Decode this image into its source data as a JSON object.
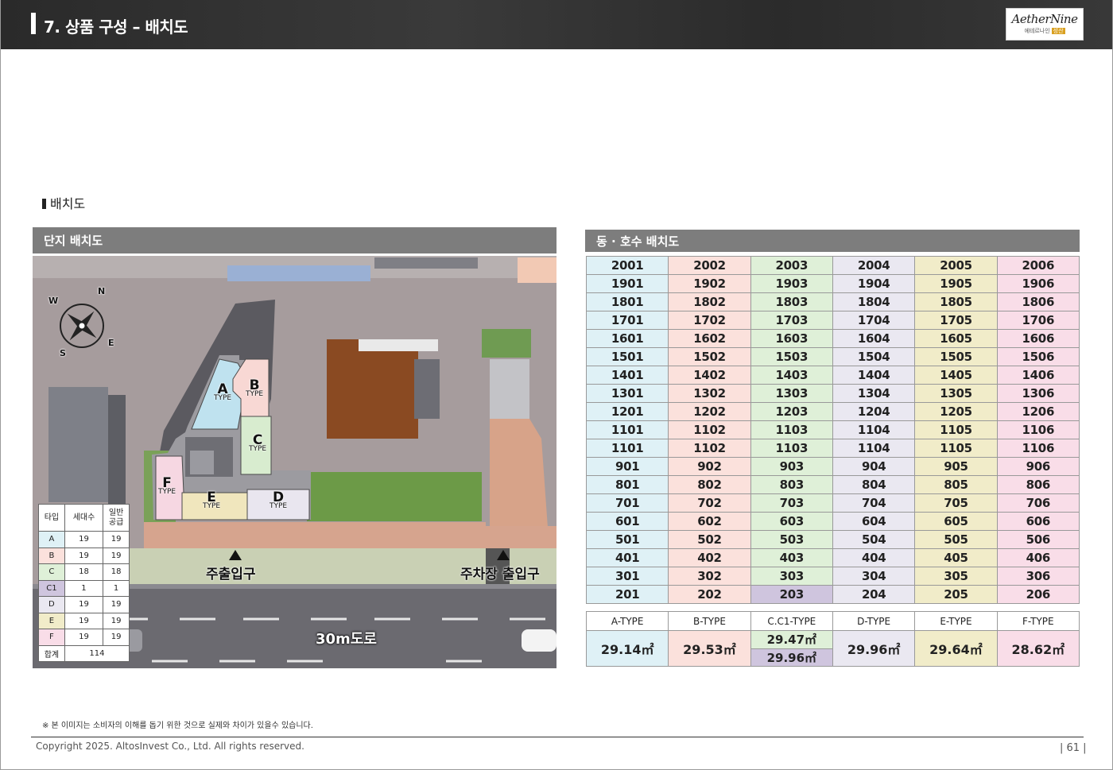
{
  "header": {
    "title": "7. 상품 구성 – 배치도",
    "logo": {
      "name": "AetherNine",
      "sub": "에테르나인",
      "tag": "성산"
    }
  },
  "section_label": "배치도",
  "left_panel": {
    "title": "단지 배치도",
    "compass": [
      "N",
      "E",
      "S",
      "W"
    ],
    "building_labels": [
      {
        "letter": "A",
        "type": "TYPE"
      },
      {
        "letter": "B",
        "type": "TYPE"
      },
      {
        "letter": "C",
        "type": "TYPE"
      },
      {
        "letter": "F",
        "type": "TYPE"
      },
      {
        "letter": "E",
        "type": "TYPE"
      },
      {
        "letter": "D",
        "type": "TYPE"
      }
    ],
    "main_entrance": "주출입구",
    "parking_entrance": "주차장 출입구",
    "road": "30m도로",
    "legend": {
      "headers": [
        "타입",
        "세대수",
        "일반\n공급"
      ],
      "rows": [
        {
          "type": "A",
          "units": "19",
          "supply": "19",
          "color": "#dff1f6"
        },
        {
          "type": "B",
          "units": "19",
          "supply": "19",
          "color": "#fbe1dc"
        },
        {
          "type": "C",
          "units": "18",
          "supply": "18",
          "color": "#dff0d8"
        },
        {
          "type": "C1",
          "units": "1",
          "supply": "1",
          "color": "#cfc5de"
        },
        {
          "type": "D",
          "units": "19",
          "supply": "19",
          "color": "#eae8f1"
        },
        {
          "type": "E",
          "units": "19",
          "supply": "19",
          "color": "#f1ecc9"
        },
        {
          "type": "F",
          "units": "19",
          "supply": "19",
          "color": "#f9dde8"
        }
      ],
      "total_label": "합계",
      "total": "114"
    }
  },
  "right_panel": {
    "title": "동 · 호수 배치도",
    "rows": [
      [
        "2001",
        "2002",
        "2003",
        "2004",
        "2005",
        "2006"
      ],
      [
        "1901",
        "1902",
        "1903",
        "1904",
        "1905",
        "1906"
      ],
      [
        "1801",
        "1802",
        "1803",
        "1804",
        "1805",
        "1806"
      ],
      [
        "1701",
        "1702",
        "1703",
        "1704",
        "1705",
        "1706"
      ],
      [
        "1601",
        "1602",
        "1603",
        "1604",
        "1605",
        "1606"
      ],
      [
        "1501",
        "1502",
        "1503",
        "1504",
        "1505",
        "1506"
      ],
      [
        "1401",
        "1402",
        "1403",
        "1404",
        "1405",
        "1406"
      ],
      [
        "1301",
        "1302",
        "1303",
        "1304",
        "1305",
        "1306"
      ],
      [
        "1201",
        "1202",
        "1203",
        "1204",
        "1205",
        "1206"
      ],
      [
        "1101",
        "1102",
        "1103",
        "1104",
        "1105",
        "1106"
      ],
      [
        "1101",
        "1102",
        "1103",
        "1104",
        "1105",
        "1106"
      ],
      [
        "901",
        "902",
        "903",
        "904",
        "905",
        "906"
      ],
      [
        "801",
        "802",
        "803",
        "804",
        "805",
        "806"
      ],
      [
        "701",
        "702",
        "703",
        "704",
        "705",
        "706"
      ],
      [
        "601",
        "602",
        "603",
        "604",
        "605",
        "606"
      ],
      [
        "501",
        "502",
        "503",
        "504",
        "505",
        "506"
      ],
      [
        "401",
        "402",
        "403",
        "404",
        "405",
        "406"
      ],
      [
        "301",
        "302",
        "303",
        "304",
        "305",
        "306"
      ],
      [
        "201",
        "202",
        "203",
        "204",
        "205",
        "206"
      ]
    ],
    "highlight_cell": {
      "row": 18,
      "col": 2,
      "color": "#cfc5de"
    },
    "column_colors": [
      "#dff1f6",
      "#fbe1dc",
      "#dff0d8",
      "#eae8f1",
      "#f1ecc9",
      "#f9dde8"
    ],
    "types": [
      {
        "label": "A-TYPE",
        "area": "29.14㎡"
      },
      {
        "label": "B-TYPE",
        "area": "29.53㎡"
      },
      {
        "label": "C.C1-TYPE",
        "area": "29.47㎡",
        "area2": "29.96㎡"
      },
      {
        "label": "D-TYPE",
        "area": "29.96㎡"
      },
      {
        "label": "E-TYPE",
        "area": "29.64㎡"
      },
      {
        "label": "F-TYPE",
        "area": "28.62㎡"
      }
    ]
  },
  "footer": {
    "note": "※ 본 이미지는 소비자의 이해를 돕기 위한 것으로 실제와 차이가 있을수 있습니다.",
    "copyright": "Copyright 2025. AltosInvest Co., Ltd. All rights reserved.",
    "page": "| 61 |"
  }
}
